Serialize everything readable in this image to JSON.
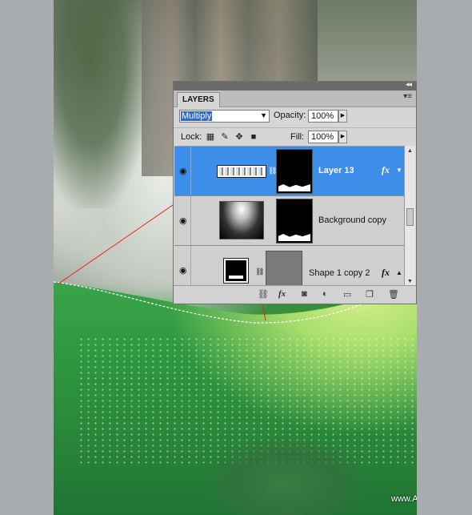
{
  "panel": {
    "tab_label": "LAYERS",
    "collapse_glyph": "◂◂",
    "menu_glyph": "▾≡",
    "blend_mode": "Multiply",
    "opacity_label": "Opacity:",
    "opacity_value": "100%",
    "lock_label": "Lock:",
    "fill_label": "Fill:",
    "fill_value": "100%",
    "layers": [
      {
        "name": "Layer 13",
        "selected": true,
        "has_fx": true,
        "fx": "fx"
      },
      {
        "name": "Background copy",
        "selected": false,
        "has_fx": false
      },
      {
        "name": "Shape 1 copy 2",
        "selected": false,
        "has_fx": true,
        "fx": "fx"
      }
    ],
    "bottom_icons": [
      "link-icon",
      "fx-icon",
      "mask-icon",
      "adjustment-icon",
      "folder-icon",
      "new-layer-icon",
      "trash-icon"
    ]
  },
  "watermark": "www.Alfoart.com",
  "colors": {
    "selected_layer": "#3d8ee8",
    "blend_highlight": "#3169c6",
    "annotation_line": "#e8231a"
  }
}
